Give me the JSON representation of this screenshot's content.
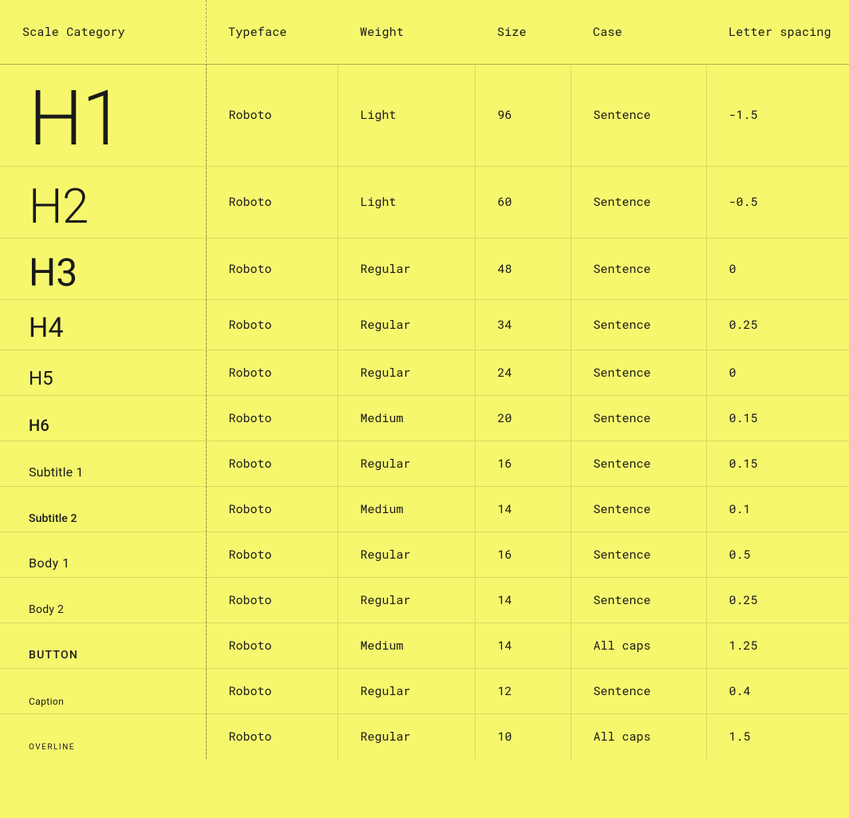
{
  "headers": {
    "scale": "Scale Category",
    "typeface": "Typeface",
    "weight": "Weight",
    "size": "Size",
    "case": "Case",
    "spacing": "Letter spacing"
  },
  "rows": [
    {
      "label": "H1",
      "typeface": "Roboto",
      "weight": "Light",
      "size": "96",
      "case": "Sentence",
      "spacing": "-1.5",
      "style": {
        "fontSize": "96px",
        "fontWeight": "300",
        "letterSpacing": "-1.5px",
        "textTransform": "none"
      }
    },
    {
      "label": "H2",
      "typeface": "Roboto",
      "weight": "Light",
      "size": "60",
      "case": "Sentence",
      "spacing": "-0.5",
      "style": {
        "fontSize": "60px",
        "fontWeight": "300",
        "letterSpacing": "-0.5px",
        "textTransform": "none"
      }
    },
    {
      "label": "H3",
      "typeface": "Roboto",
      "weight": "Regular",
      "size": "48",
      "case": "Sentence",
      "spacing": "0",
      "style": {
        "fontSize": "48px",
        "fontWeight": "400",
        "letterSpacing": "0px",
        "textTransform": "none"
      }
    },
    {
      "label": "H4",
      "typeface": "Roboto",
      "weight": "Regular",
      "size": "34",
      "case": "Sentence",
      "spacing": "0.25",
      "style": {
        "fontSize": "34px",
        "fontWeight": "400",
        "letterSpacing": "0.25px",
        "textTransform": "none"
      }
    },
    {
      "label": "H5",
      "typeface": "Roboto",
      "weight": "Regular",
      "size": "24",
      "case": "Sentence",
      "spacing": "0",
      "style": {
        "fontSize": "24px",
        "fontWeight": "400",
        "letterSpacing": "0px",
        "textTransform": "none"
      }
    },
    {
      "label": "H6",
      "typeface": "Roboto",
      "weight": "Medium",
      "size": "20",
      "case": "Sentence",
      "spacing": "0.15",
      "style": {
        "fontSize": "20px",
        "fontWeight": "500",
        "letterSpacing": "0.15px",
        "textTransform": "none"
      }
    },
    {
      "label": "Subtitle 1",
      "typeface": "Roboto",
      "weight": "Regular",
      "size": "16",
      "case": "Sentence",
      "spacing": "0.15",
      "style": {
        "fontSize": "16px",
        "fontWeight": "400",
        "letterSpacing": "0.15px",
        "textTransform": "none"
      }
    },
    {
      "label": "Subtitle 2",
      "typeface": "Roboto",
      "weight": "Medium",
      "size": "14",
      "case": "Sentence",
      "spacing": "0.1",
      "style": {
        "fontSize": "14px",
        "fontWeight": "500",
        "letterSpacing": "0.1px",
        "textTransform": "none"
      }
    },
    {
      "label": "Body 1",
      "typeface": "Roboto",
      "weight": "Regular",
      "size": "16",
      "case": "Sentence",
      "spacing": "0.5",
      "style": {
        "fontSize": "16px",
        "fontWeight": "400",
        "letterSpacing": "0.5px",
        "textTransform": "none"
      }
    },
    {
      "label": "Body 2",
      "typeface": "Roboto",
      "weight": "Regular",
      "size": "14",
      "case": "Sentence",
      "spacing": "0.25",
      "style": {
        "fontSize": "14px",
        "fontWeight": "400",
        "letterSpacing": "0.25px",
        "textTransform": "none"
      }
    },
    {
      "label": "BUTTON",
      "typeface": "Roboto",
      "weight": "Medium",
      "size": "14",
      "case": "All caps",
      "spacing": "1.25",
      "style": {
        "fontSize": "14px",
        "fontWeight": "500",
        "letterSpacing": "1.25px",
        "textTransform": "uppercase"
      }
    },
    {
      "label": "Caption",
      "typeface": "Roboto",
      "weight": "Regular",
      "size": "12",
      "case": "Sentence",
      "spacing": "0.4",
      "style": {
        "fontSize": "12px",
        "fontWeight": "400",
        "letterSpacing": "0.4px",
        "textTransform": "none"
      }
    },
    {
      "label": "OVERLINE",
      "typeface": "Roboto",
      "weight": "Regular",
      "size": "10",
      "case": "All caps",
      "spacing": "1.5",
      "style": {
        "fontSize": "10px",
        "fontWeight": "400",
        "letterSpacing": "1.5px",
        "textTransform": "uppercase"
      }
    }
  ]
}
